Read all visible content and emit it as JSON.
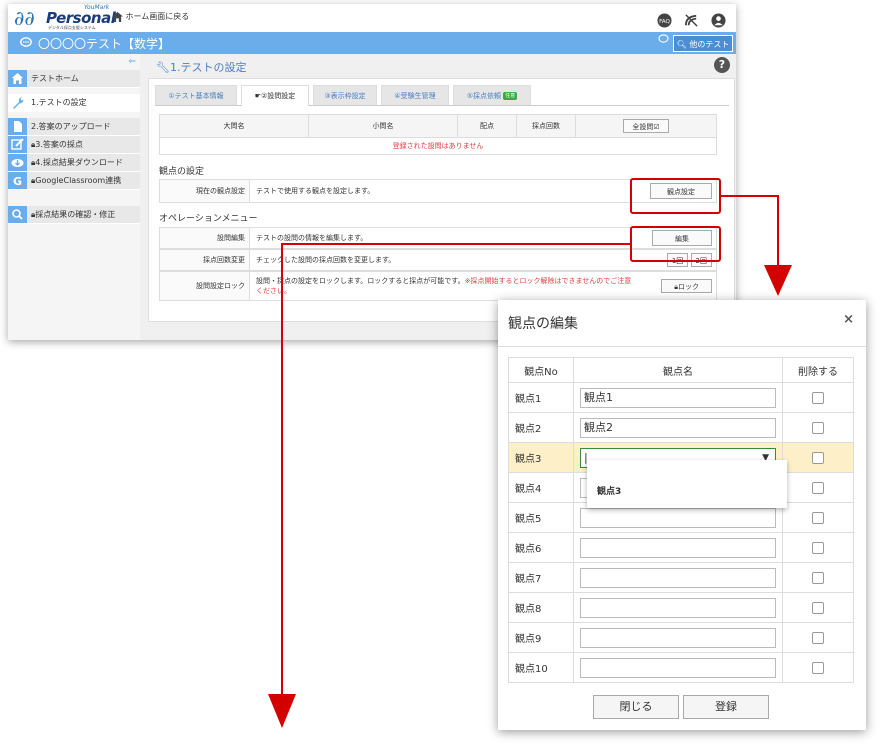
{
  "header": {
    "logo_brand": "Personal",
    "logo_sub": "YouMark",
    "logo_tagline": "デジタル採点支援システム",
    "home_link": "ホーム画面に戻る",
    "test_title": "〇〇〇〇テスト【数学】",
    "other_test_button": "他のテスト"
  },
  "sidebar": {
    "items": [
      {
        "label": "テストホーム",
        "icon": "home-icon"
      },
      {
        "label": "1.テストの設定",
        "icon": "wrench-icon"
      },
      {
        "label": "2.答案のアップロード",
        "icon": "document-icon"
      },
      {
        "label": "3.答案の採点",
        "icon": "edit-icon"
      },
      {
        "label": "4.採点結果ダウンロード",
        "icon": "cloud-download-icon"
      },
      {
        "label": "GoogleClassroom連携",
        "icon": "google-icon"
      },
      {
        "label": "採点結果の確認・修正",
        "icon": "search-icon"
      }
    ]
  },
  "main": {
    "title": "1.テストの設定",
    "tabs": [
      {
        "label": "①テスト基本情報"
      },
      {
        "label": "②設問設定"
      },
      {
        "label": "③表示枠設定"
      },
      {
        "label": "④受験生管理"
      },
      {
        "label": "⑤採点依頼",
        "badge": "任意"
      }
    ],
    "question_table": {
      "headers": [
        "大問名",
        "小問名",
        "配点",
        "採点回数"
      ],
      "all_questions_button": "全設問☑",
      "empty_message": "登録された設問はありません"
    },
    "viewpoint_section": {
      "heading": "観点の設定",
      "label": "現在の観点設定",
      "description": "テストで使用する観点を設定します。",
      "button": "観点設定"
    },
    "operation_section": {
      "heading": "オペレーションメニュー",
      "rows": [
        {
          "label": "設問編集",
          "description": "テストの設問の情報を編集します。",
          "button": "編集"
        },
        {
          "label": "採点回数変更",
          "description": "チェックした設問の採点回数を変更します。",
          "button1": "1回",
          "button2": "2回"
        },
        {
          "label": "設問設定ロック",
          "description": "設問・採点の設定をロックします。ロックすると採点が可能です。",
          "warning": "※採点開始するとロック解除はできませんのでご注意ください。",
          "button": "ロック"
        }
      ]
    }
  },
  "modal": {
    "title": "観点の編集",
    "close": "×",
    "headers": [
      "観点No",
      "観点名",
      "削除する"
    ],
    "rows": [
      {
        "no": "観点1",
        "name": "観点1"
      },
      {
        "no": "観点2",
        "name": "観点2"
      },
      {
        "no": "観点3",
        "name": "|"
      },
      {
        "no": "観点4",
        "name": ""
      },
      {
        "no": "観点5",
        "name": ""
      },
      {
        "no": "観点6",
        "name": ""
      },
      {
        "no": "観点7",
        "name": ""
      },
      {
        "no": "観点8",
        "name": ""
      },
      {
        "no": "観点9",
        "name": ""
      },
      {
        "no": "観点10",
        "name": ""
      }
    ],
    "dropdown_option": "観点3",
    "close_button": "閉じる",
    "register_button": "登録"
  },
  "colors": {
    "accent": "#6aadea",
    "highlight": "#d40000",
    "row_highlight": "#fdf0c8"
  }
}
